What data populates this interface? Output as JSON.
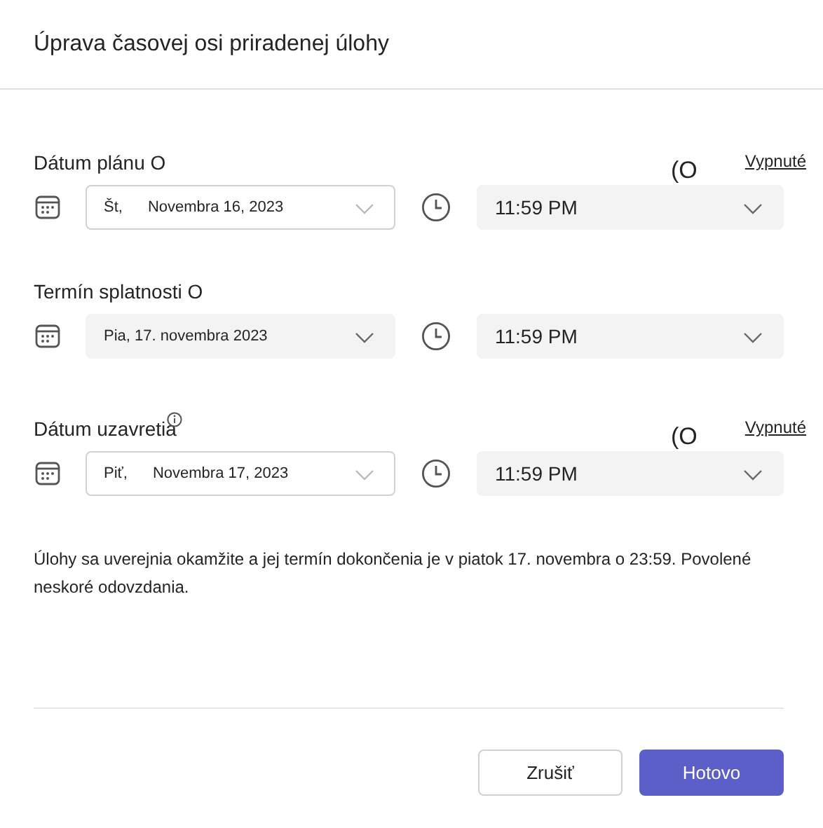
{
  "title": "Úprava časovej osi priradenej úlohy",
  "sections": [
    {
      "label": "Dátum plánu O",
      "info_icon": false,
      "toggle": {
        "mark": "(O",
        "label": "Vypnuté"
      },
      "date": {
        "kind": "outlined",
        "weekday": "Št,",
        "value": "Novembra 16, 2023"
      },
      "time": "11:59 PM"
    },
    {
      "label": "Termín splatnosti O",
      "info_icon": false,
      "date": {
        "kind": "filled",
        "value": "Pia, 17. novembra 2023"
      },
      "time": "11:59 PM"
    },
    {
      "label": "Dátum uzavretia",
      "info_icon": true,
      "toggle": {
        "mark": "(O",
        "label": "Vypnuté"
      },
      "date": {
        "kind": "outlined",
        "weekday": "Piť,",
        "value": "Novembra 17, 2023"
      },
      "time": "11:59 PM"
    }
  ],
  "summary": "Úlohy sa uverejnia okamžite a jej termín dokončenia je v piatok 17. novembra o 23:59. Povolené neskoré odovzdania.",
  "buttons": [
    {
      "label": "Zrušiť",
      "kind": "secondary"
    },
    {
      "label": "Hotovo",
      "kind": "primary"
    }
  ]
}
